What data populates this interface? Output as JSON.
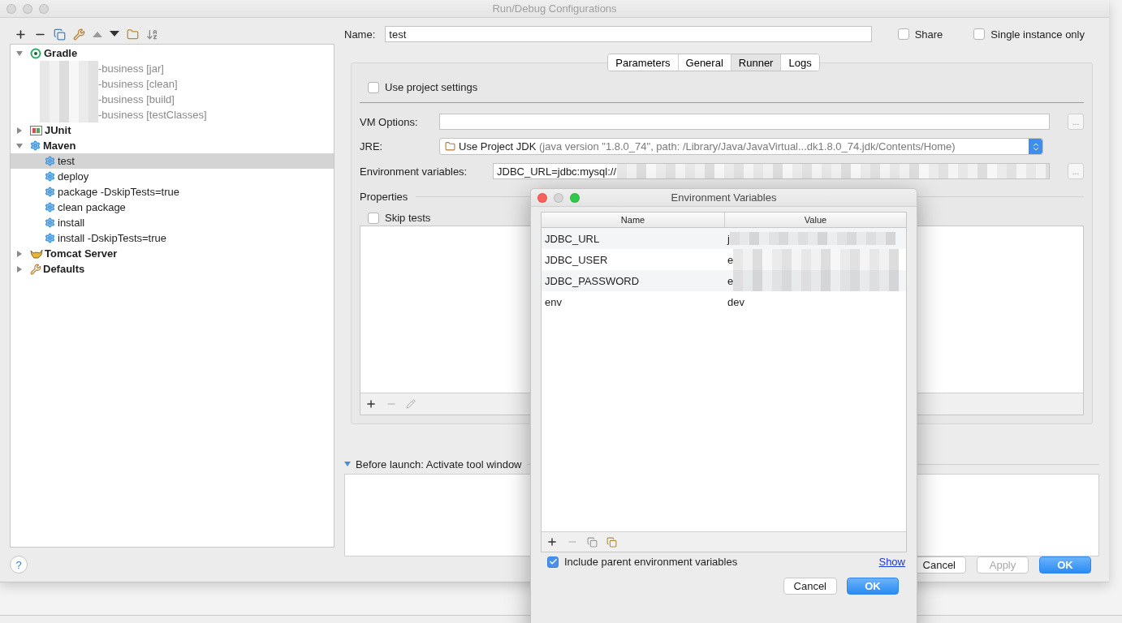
{
  "window": {
    "title": "Run/Debug Configurations"
  },
  "tree": [
    {
      "label": "Gradle",
      "kind": "gradle",
      "expanded": true,
      "selected": false,
      "disabled": false,
      "children": [
        {
          "label": "-business [jar]",
          "kind": "task",
          "redacted": true,
          "selected": false,
          "disabled": true
        },
        {
          "label": "-business [clean]",
          "kind": "task",
          "redacted": true,
          "selected": false,
          "disabled": true
        },
        {
          "label": "-business [build]",
          "kind": "task",
          "redacted": true,
          "selected": false,
          "disabled": true
        },
        {
          "label": "-business [testClasses]",
          "kind": "task",
          "redacted": true,
          "selected": false,
          "disabled": true
        }
      ]
    },
    {
      "label": "JUnit",
      "kind": "junit",
      "expanded": false,
      "selected": false,
      "disabled": false
    },
    {
      "label": "Maven",
      "kind": "maven",
      "expanded": true,
      "selected": false,
      "disabled": false,
      "children": [
        {
          "label": "test",
          "kind": "maven",
          "redacted": false,
          "selected": true,
          "disabled": false
        },
        {
          "label": "deploy",
          "kind": "maven",
          "redacted": false,
          "selected": false,
          "disabled": false
        },
        {
          "label": "package -DskipTests=true",
          "kind": "maven",
          "redacted": false,
          "selected": false,
          "disabled": false
        },
        {
          "label": "clean package",
          "kind": "maven",
          "redacted": false,
          "selected": false,
          "disabled": false
        },
        {
          "label": "install",
          "kind": "maven",
          "redacted": false,
          "selected": false,
          "disabled": false
        },
        {
          "label": "install  -DskipTests=true",
          "kind": "maven",
          "redacted": false,
          "selected": false,
          "disabled": false
        }
      ]
    },
    {
      "label": "Tomcat Server",
      "kind": "tomcat",
      "expanded": false,
      "selected": false,
      "disabled": false
    },
    {
      "label": "Defaults",
      "kind": "defaults",
      "expanded": false,
      "selected": false,
      "disabled": false
    }
  ],
  "help": "?",
  "name_field": {
    "label": "Name:",
    "value": "test"
  },
  "share": {
    "label": "Share",
    "checked": false
  },
  "single_instance": {
    "label": "Single instance only",
    "checked": false
  },
  "tabs": [
    {
      "label": "Parameters",
      "selected": false
    },
    {
      "label": "General",
      "selected": false
    },
    {
      "label": "Runner",
      "selected": true
    },
    {
      "label": "Logs",
      "selected": false
    }
  ],
  "use_project_settings": {
    "label": "Use project settings",
    "checked": false
  },
  "vm_options": {
    "label": "VM Options:",
    "more": "..."
  },
  "jre": {
    "label": "JRE:",
    "value": "Use Project JDK",
    "detail": "(java version \"1.8.0_74\", path: /Library/Java/JavaVirtual...dk1.8.0_74.jdk/Contents/Home)"
  },
  "env_vars": {
    "label": "Environment variables:",
    "value": "JDBC_URL=jdbc:mysql://",
    "redacted": true,
    "more": "..."
  },
  "properties": {
    "label": "Properties",
    "skip_tests": {
      "label": "Skip tests",
      "checked": false
    }
  },
  "before_launch": {
    "label": "Before launch: Activate tool window",
    "expanded": true
  },
  "buttons": [
    {
      "label": "Cancel",
      "kind": "normal",
      "disabled": false
    },
    {
      "label": "Apply",
      "kind": "normal",
      "disabled": true
    },
    {
      "label": "OK",
      "kind": "default",
      "disabled": false
    }
  ],
  "dialog": {
    "title": "Environment Variables",
    "columns": [
      "Name",
      "Value"
    ],
    "rows": [
      {
        "name": "JDBC_URL",
        "value": "j",
        "redacted": true
      },
      {
        "name": "JDBC_USER",
        "value": "e",
        "redacted": true
      },
      {
        "name": "JDBC_PASSWORD",
        "value": "e",
        "redacted": true
      },
      {
        "name": "env",
        "value": "dev",
        "redacted": false
      }
    ],
    "include_parent": {
      "label": "Include parent environment variables",
      "checked": true
    },
    "show_link": "Show",
    "buttons": [
      {
        "label": "Cancel",
        "kind": "normal"
      },
      {
        "label": "OK",
        "kind": "default"
      }
    ]
  }
}
